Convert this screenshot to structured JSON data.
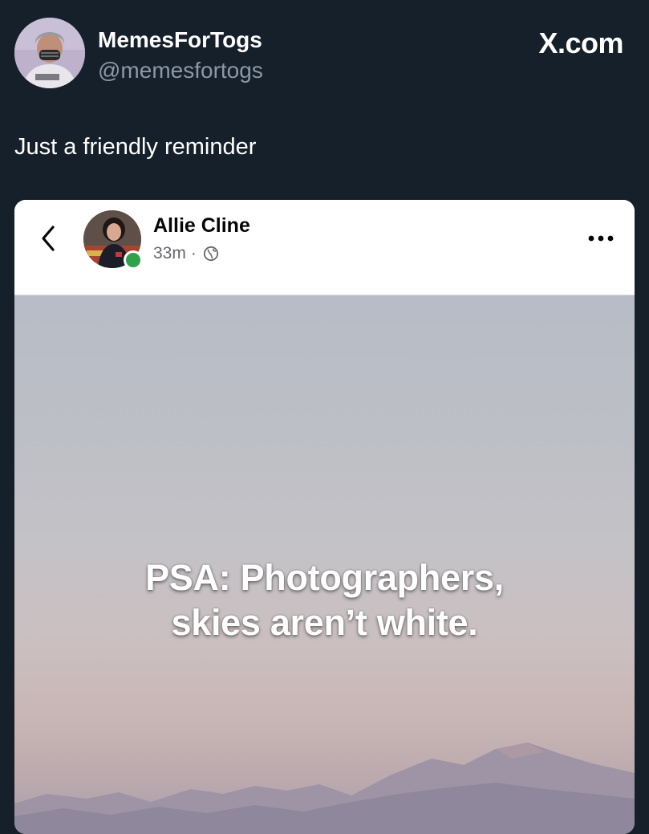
{
  "tweet": {
    "author": {
      "display_name": "MemesForTogs",
      "handle": "@memesfortogs"
    },
    "brand": "X.com",
    "text": "Just a friendly reminder"
  },
  "embedded_post": {
    "author_name": "Allie Cline",
    "time": "33m",
    "separator": "·",
    "privacy_icon": "globe-icon",
    "back_icon": "chevron-left-icon",
    "more_icon": "more-horizontal-icon",
    "online_status_color": "#31a24c",
    "image_text": {
      "line1": "PSA: Photographers,",
      "line2": "skies aren’t white."
    }
  },
  "colors": {
    "background": "#15202b",
    "handle_gray": "#8b98a5",
    "card_background": "#ffffff"
  }
}
